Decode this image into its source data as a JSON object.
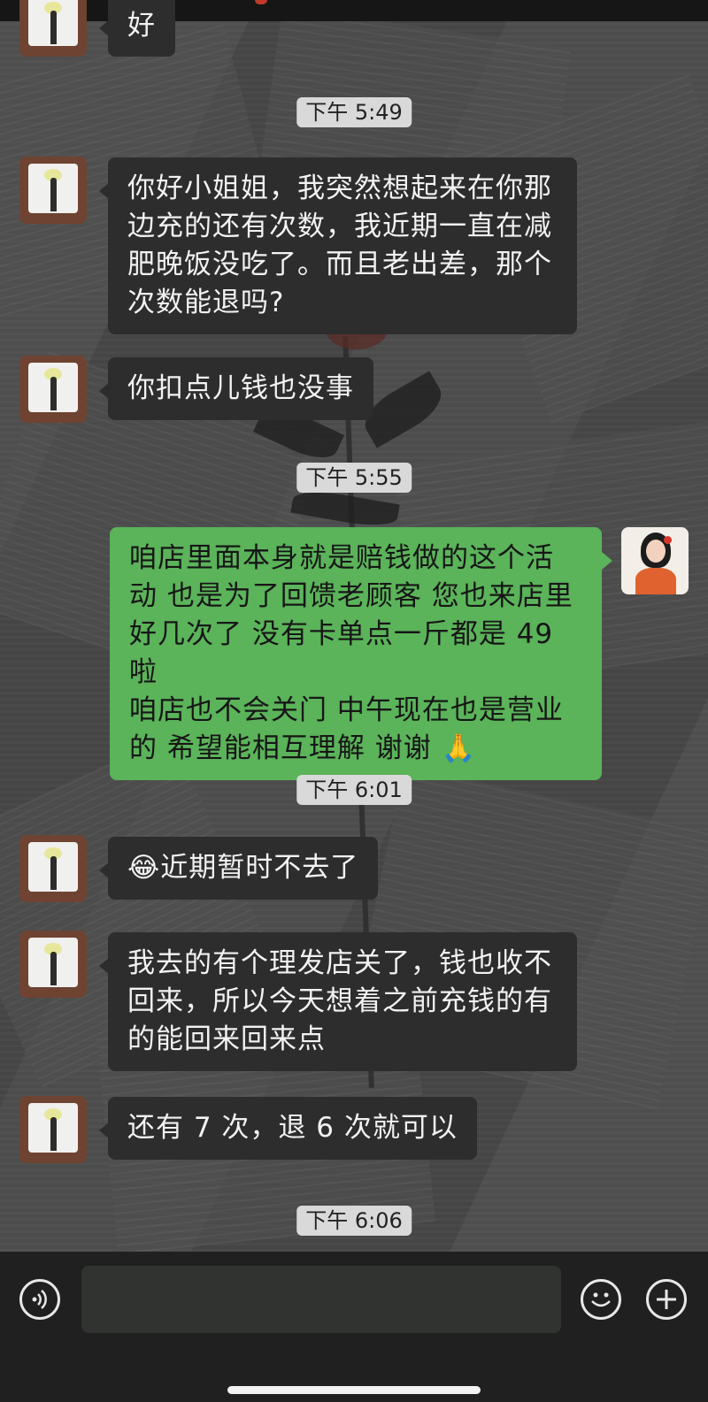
{
  "messages": [
    {
      "side": "left",
      "text": "好"
    },
    {
      "side": "time",
      "text": "下午 5:49"
    },
    {
      "side": "left",
      "lines": [
        "你好小姐姐，我突然想起来在你那",
        "边充的还有次数，我近期一直在减",
        "肥晚饭没吃了。而且老出差，那个",
        "次数能退吗?"
      ]
    },
    {
      "side": "left",
      "text": "你扣点儿钱也没事"
    },
    {
      "side": "time",
      "text": "下午 5:55"
    },
    {
      "side": "right",
      "lines": [
        "咱店里面本身就是赔钱做的这个活",
        "动 也是为了回馈老顾客 您也来店里",
        "好几次了 没有卡单点一斤都是 49 啦",
        "咱店也不会关门 中午现在也是营业",
        "的 希望能相互理解 谢谢"
      ],
      "emoji": "🙏"
    },
    {
      "side": "time",
      "text": "下午 6:01"
    },
    {
      "side": "left",
      "emoji": "😂",
      "text": "近期暂时不去了"
    },
    {
      "side": "left",
      "lines": [
        "我去的有个理发店关了，钱也收不",
        "回来，所以今天想着之前充钱的有",
        "的能回来回来点"
      ]
    },
    {
      "side": "left",
      "text": "还有 7 次，退 6 次就可以"
    },
    {
      "side": "time",
      "text": "下午 6:06"
    }
  ],
  "composer": {
    "voice_icon": "voice-icon",
    "emoji_icon": "emoji-smile-icon",
    "plus_icon": "plus-icon",
    "input_value": ""
  },
  "colors": {
    "my_bubble": "#5bb35a",
    "other_bubble": "#2d2d2d",
    "timestamp_bg": "#d9d9d9"
  }
}
